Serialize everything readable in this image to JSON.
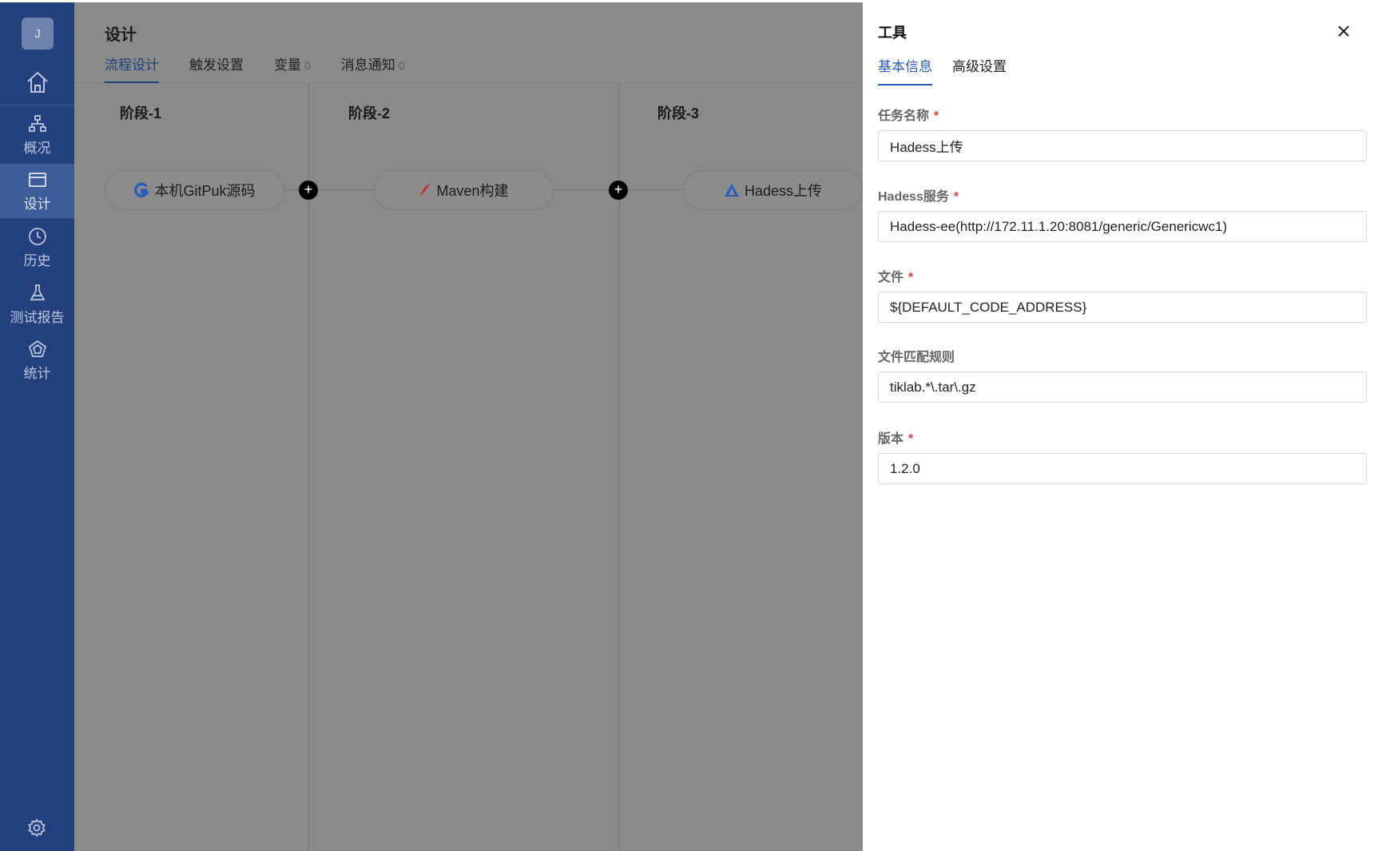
{
  "sidebar": {
    "avatar": "J",
    "items": [
      {
        "label": "概况",
        "icon": "sitemap-icon"
      },
      {
        "label": "设计",
        "icon": "card-icon"
      },
      {
        "label": "历史",
        "icon": "clock-icon"
      },
      {
        "label": "测试报告",
        "icon": "flask-icon"
      },
      {
        "label": "统计",
        "icon": "pentagon-icon"
      }
    ]
  },
  "header": {
    "title": "设计",
    "tabs": [
      {
        "label": "流程设计",
        "count": ""
      },
      {
        "label": "触发设置",
        "count": ""
      },
      {
        "label": "变量",
        "count": "0"
      },
      {
        "label": "消息通知",
        "count": "0"
      }
    ]
  },
  "stages": [
    {
      "title": "阶段-1",
      "task": "本机GitPuk源码",
      "task_icon": "gitpuk-icon"
    },
    {
      "title": "阶段-2",
      "task": "Maven构建",
      "task_icon": "maven-feather-icon"
    },
    {
      "title": "阶段-3",
      "task": "Hadess上传",
      "task_icon": "hadess-icon"
    }
  ],
  "panel": {
    "title": "工具",
    "tabs": [
      "基本信息",
      "高级设置"
    ],
    "fields": [
      {
        "label": "任务名称",
        "required": true,
        "value": "Hadess上传"
      },
      {
        "label": "Hadess服务",
        "required": true,
        "value": "Hadess-ee(http://172.11.1.20:8081/generic/Genericwc1)"
      },
      {
        "label": "文件",
        "required": true,
        "value": "${DEFAULT_CODE_ADDRESS}"
      },
      {
        "label": "文件匹配规则",
        "required": false,
        "value": "tiklab.*\\.tar\\.gz"
      },
      {
        "label": "版本",
        "required": true,
        "value": "1.2.0"
      }
    ],
    "required_mark": "*"
  },
  "colors": {
    "sidebar_bg": "#24417d",
    "accent": "#2a5bb8",
    "required": "#e03a3a"
  }
}
